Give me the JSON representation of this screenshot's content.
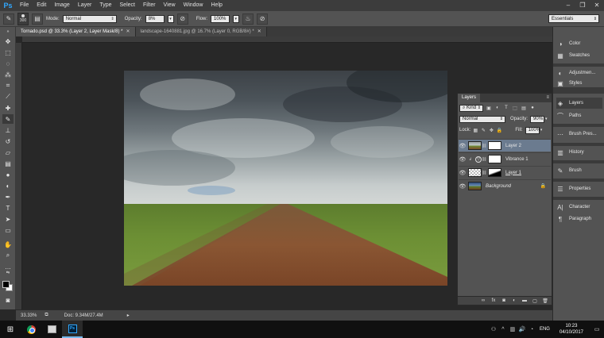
{
  "app": {
    "logo": "Ps"
  },
  "menu": [
    "File",
    "Edit",
    "Image",
    "Layer",
    "Type",
    "Select",
    "Filter",
    "View",
    "Window",
    "Help"
  ],
  "window_controls": {
    "minimize": "–",
    "restore": "❐",
    "close": "✕"
  },
  "options": {
    "brush_size": "300",
    "mode_label": "Mode:",
    "mode_value": "Normal",
    "opacity_label": "Opacity:",
    "opacity_value": "8%",
    "flow_label": "Flow:",
    "flow_value": "100%",
    "workspace": "Essentials"
  },
  "doc_tabs": [
    {
      "label": "Tornado.psd @ 33.3% (Layer 2, Layer Mask/8) *",
      "active": true
    },
    {
      "label": "landscape-1640881.jpg @ 16.7% (Layer 0, RGB/8#) *",
      "active": false
    }
  ],
  "status": {
    "zoom": "33.33%",
    "doc": "Doc: 9.34M/27.4M"
  },
  "collapsed_panels": [
    {
      "label": "Color",
      "icon": "color-icon"
    },
    {
      "label": "Swatches",
      "icon": "swatches-icon"
    },
    {
      "label": "Adjustmen...",
      "icon": "adjustments-icon"
    },
    {
      "label": "Styles",
      "icon": "styles-icon"
    },
    {
      "label": "Layers",
      "icon": "layers-icon"
    },
    {
      "label": "Paths",
      "icon": "paths-icon"
    },
    {
      "label": "Brush Pres...",
      "icon": "brush-presets-icon"
    },
    {
      "label": "History",
      "icon": "history-icon"
    },
    {
      "label": "Brush",
      "icon": "brush-icon"
    },
    {
      "label": "Properties",
      "icon": "properties-icon"
    },
    {
      "label": "Character",
      "icon": "character-icon"
    },
    {
      "label": "Paragraph",
      "icon": "paragraph-icon"
    }
  ],
  "layers_panel": {
    "tab": "Layers",
    "kind": "Kind",
    "blend_mode": "Normal",
    "opacity_label": "Opacity:",
    "opacity_value": "90%",
    "lock_label": "Lock:",
    "fill_label": "Fill:",
    "fill_value": "100%",
    "layers": [
      {
        "name": "Layer 2",
        "selected": true
      },
      {
        "name": "Vibrance 1",
        "selected": false
      },
      {
        "name": "Layer 1",
        "selected": false
      },
      {
        "name": "Background",
        "selected": false,
        "locked": true
      }
    ]
  },
  "taskbar": {
    "language": "ENG",
    "time": "10:23",
    "date": "04/10/2017"
  }
}
